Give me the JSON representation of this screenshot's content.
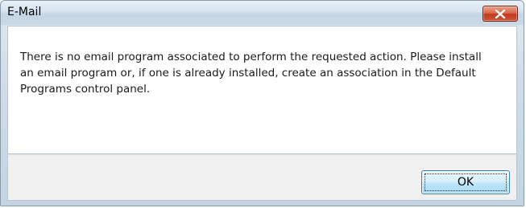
{
  "dialog": {
    "title": "E-Mail",
    "close_icon": "close-icon",
    "message": "There is no email program associated to perform the requested action. Please install an email program or, if one is already installed, create an association in the Default Programs control panel.",
    "ok_label": "OK"
  },
  "colors": {
    "close_button": "#c23a1c",
    "ok_button": "#bee6fd",
    "footer": "#f0f0f0"
  }
}
